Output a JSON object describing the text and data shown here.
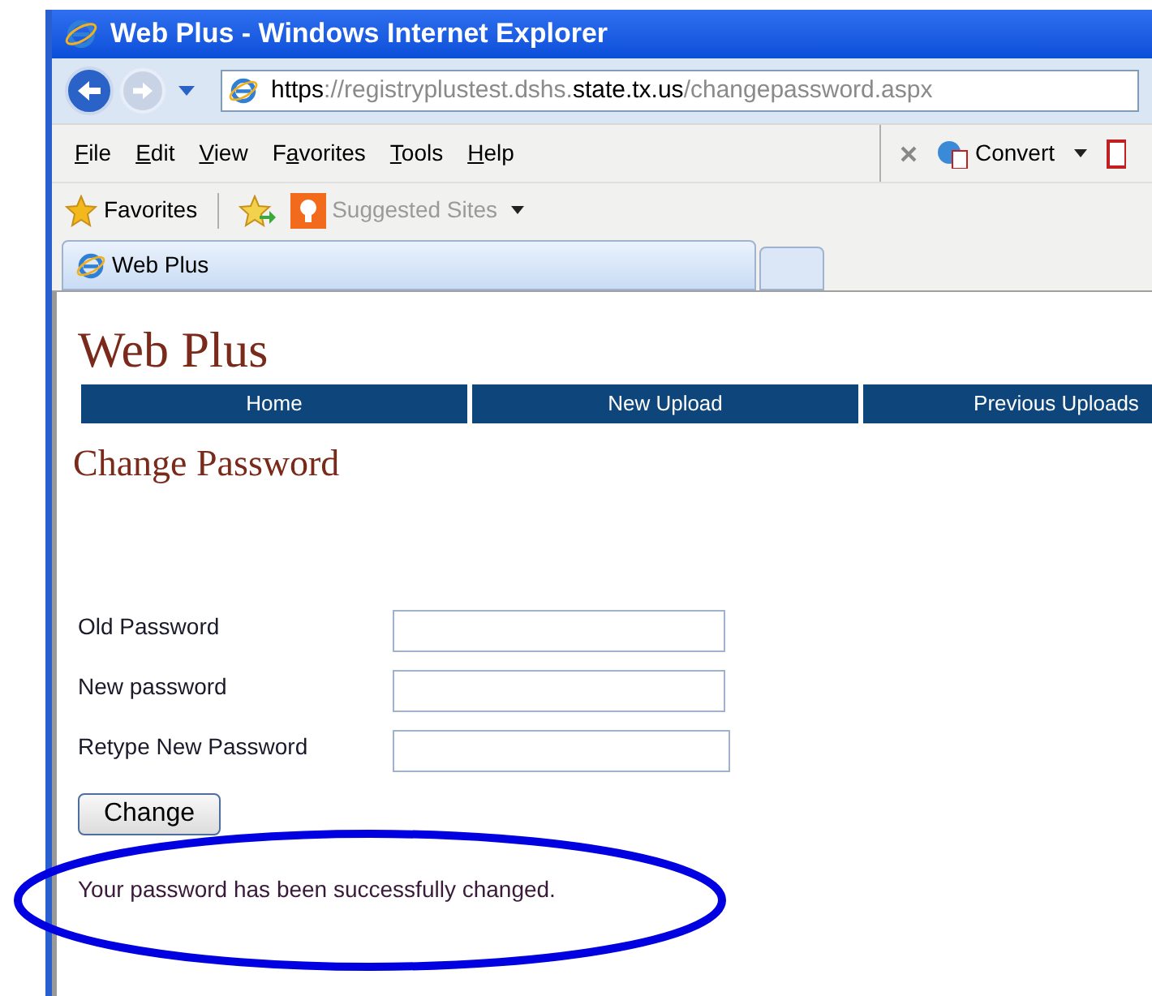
{
  "window": {
    "title": "Web Plus - Windows Internet Explorer"
  },
  "address_bar": {
    "url_parts": [
      {
        "text": "https",
        "emphasis": true
      },
      {
        "text": "://registryplustest.dshs.",
        "emphasis": false
      },
      {
        "text": "state.tx.us",
        "emphasis": true
      },
      {
        "text": "/changepassword.aspx",
        "emphasis": false
      }
    ]
  },
  "menu_bar": {
    "items": [
      {
        "key": "F",
        "after": "ile"
      },
      {
        "key": "E",
        "after": "dit"
      },
      {
        "key": "V",
        "after": "iew"
      },
      {
        "before": "F",
        "key": "a",
        "after": "vorites"
      },
      {
        "key": "T",
        "after": "ools"
      },
      {
        "key": "H",
        "after": "elp"
      }
    ],
    "convert": "Convert"
  },
  "favorites_bar": {
    "favorites": "Favorites",
    "suggested": "Suggested Sites"
  },
  "tabs": [
    {
      "label": "Web Plus",
      "selected": true
    }
  ],
  "page": {
    "site_title": "Web Plus",
    "nav": [
      {
        "label": "Home"
      },
      {
        "label": "New Upload"
      },
      {
        "label": "Previous Uploads"
      }
    ],
    "heading": "Change Password",
    "fields": [
      {
        "label": "Old Password"
      },
      {
        "label": "New password"
      },
      {
        "label": "Retype New Password"
      }
    ],
    "submit": "Change",
    "message": "Your password has been successfully changed."
  }
}
